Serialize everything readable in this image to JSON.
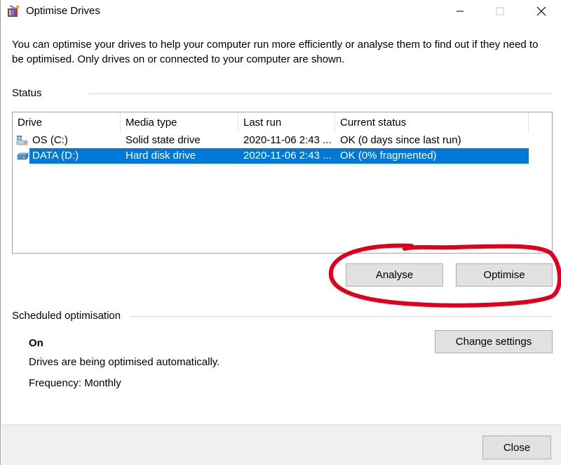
{
  "window": {
    "title": "Optimise Drives"
  },
  "intro_text": "You can optimise your drives to help your computer run more efficiently or analyse them to find out if they need to be optimised. Only drives on or connected to your computer are shown.",
  "status": {
    "section_label": "Status",
    "columns": [
      "Drive",
      "Media type",
      "Last run",
      "Current status"
    ],
    "drives": [
      {
        "drive": "OS (C:)",
        "media_type": "Solid state drive",
        "last_run": "2020-11-06 2:43 ...",
        "current_status": "OK (0 days since last run)",
        "icon": "windows-drive-icon",
        "selected": false
      },
      {
        "drive": "DATA (D:)",
        "media_type": "Hard disk drive",
        "last_run": "2020-11-06 2:43 ...",
        "current_status": "OK (0% fragmented)",
        "icon": "hard-drive-icon",
        "selected": true
      }
    ],
    "analyse_label": "Analyse",
    "optimise_label": "Optimise"
  },
  "scheduled": {
    "section_label": "Scheduled optimisation",
    "state": "On",
    "description": "Drives are being optimised automatically.",
    "frequency": "Frequency: Monthly",
    "change_settings_label": "Change settings"
  },
  "footer": {
    "close_label": "Close"
  },
  "colors": {
    "selection": "#0078d7",
    "annotation": "#e0001b",
    "button_face": "#e1e1e1"
  }
}
